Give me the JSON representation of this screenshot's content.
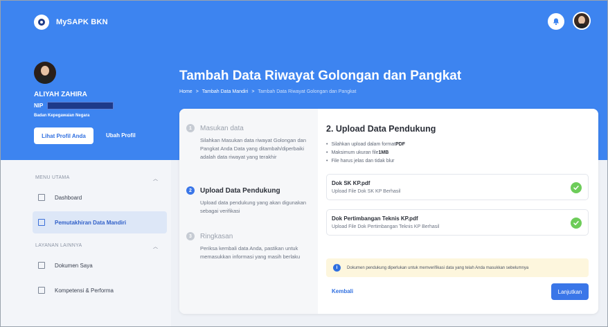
{
  "app": {
    "name": "MySAPK BKN"
  },
  "profile": {
    "name": "ALIYAH ZAHIRA",
    "nip_label": "NIP",
    "agency": "Badan Kepegawaian Negara",
    "view_profile_button": "Lihat Profil Anda",
    "edit_profile_link": "Ubah Profil"
  },
  "sidebar": {
    "main_menu_title": "MENU UTAMA",
    "other_services_title": "LAYANAN LAINNYA",
    "items": [
      {
        "label": "Dashboard",
        "icon": "grid-icon"
      },
      {
        "label": "Pemutakhiran Data Mandiri",
        "icon": "grid-icon",
        "active": true
      },
      {
        "label": "Dokumen Saya",
        "icon": "document-icon"
      },
      {
        "label": "Kompetensi & Performa",
        "icon": "qr-grid-icon"
      }
    ]
  },
  "page": {
    "title": "Tambah Data Riwayat Golongan dan Pangkat",
    "breadcrumb": [
      "Home",
      ">",
      "Tambah Data Mandiri",
      ">",
      "Tambah Data Riwayat Golongan dan Pangkat"
    ]
  },
  "steps": [
    {
      "number": "1",
      "title": "Masukan data",
      "description": "Silahkan Masukan data riwayat Golongan dan Pangkat Anda Data yang ditambah/diperbaiki adalah data riwayat yang terakhir"
    },
    {
      "number": "2",
      "title": "Upload Data Pendukung",
      "description": "Upload data pendukung yang akan digunakan sebagai verifikasi"
    },
    {
      "number": "3",
      "title": "Ringkasan",
      "description": "Periksa kembali data Anda, pastikan untuk memasukkan informasi yang masih berlaku"
    }
  ],
  "upload": {
    "title": "2. Upload Data Pendukung",
    "rules": [
      {
        "text": "Silahkan upload dalam format ",
        "bold": "PDF"
      },
      {
        "text": "Maksimum ukuran file ",
        "bold": "1MB"
      },
      {
        "text": "File harus jelas dan tidak blur",
        "bold": ""
      }
    ],
    "files": [
      {
        "name": "Dok SK KP.pdf",
        "status": "Upload File Dok SK KP Berhasil"
      },
      {
        "name": "Dok Pertimbangan Teknis KP.pdf",
        "status": "Upload File Dok Pertimbangan Teknis KP Berhasil"
      }
    ],
    "notice": "Dokumen pendukung diperlukan untuk memverifikasi data yang telah Anda masukkan sebelumnya",
    "back_button": "Kembali",
    "next_button": "Lanjutkan"
  },
  "colors": {
    "primary": "#3d84f0",
    "success": "#6dcc59",
    "notice_bg": "#fdf6dd"
  }
}
